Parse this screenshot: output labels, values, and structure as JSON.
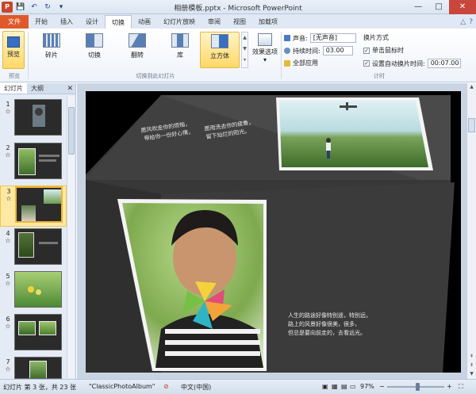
{
  "window": {
    "title": "相册模板.pptx - Microsoft PowerPoint",
    "app_icon_label": "P",
    "minimize": "—",
    "maximize": "□",
    "close": "✕"
  },
  "quick_access": {
    "save": "💾",
    "undo": "↶",
    "redo": "↻",
    "customize": "▾"
  },
  "tabs": [
    "文件",
    "开始",
    "插入",
    "设计",
    "切换",
    "动画",
    "幻灯片放映",
    "审阅",
    "视图",
    "加载项"
  ],
  "active_tab_index": 4,
  "ribbon": {
    "preview_label": "预览",
    "preview_group": "预览",
    "transitions": [
      "碎片",
      "切换",
      "翻转",
      "库",
      "立方体"
    ],
    "selected_transition": "立方体",
    "effect_options": "效果选项",
    "transition_group": "切换到此幻灯片",
    "timing_group": "计时",
    "sound_label": "声音:",
    "sound_value": "[无声音]",
    "duration_label": "持续时间:",
    "duration_value": "03.00",
    "apply_all": "全部应用",
    "advance_title": "换片方式",
    "on_click_label": "单击鼠标时",
    "on_click_checked": true,
    "auto_after_label": "设置自动换片时间:",
    "auto_after_checked": true,
    "auto_after_value": "00:07.00"
  },
  "left_panel": {
    "tab_slides": "幻灯片",
    "tab_outline": "大纲",
    "close": "✕",
    "slides": [
      {
        "number": "1",
        "mark": "☆"
      },
      {
        "number": "2",
        "mark": "☆"
      },
      {
        "number": "3",
        "mark": "☆"
      },
      {
        "number": "4",
        "mark": "☆"
      },
      {
        "number": "5",
        "mark": "☆"
      },
      {
        "number": "6",
        "mark": "☆"
      },
      {
        "number": "7",
        "mark": "☆"
      }
    ],
    "selected_slide": 3
  },
  "slide": {
    "poem_top": [
      "愿风吹走你的烦恼，",
      "带给你一份好心情，",
      "愿雨洗去你的疲惫，",
      "留下灿烂的阳光。"
    ],
    "poem_bottom": [
      "人生的路途好像特别遥，特别远，",
      "路上的风景好像很美，很多，",
      "但总是要向前走的，去看远光。"
    ]
  },
  "status": {
    "slide_info": "幻灯片 第 3 张，共 23 张",
    "theme": "\"ClassicPhotoAlbum\"",
    "language": "中文(中国)",
    "zoom": "97%",
    "zoom_minus": "−",
    "zoom_plus": "+"
  },
  "colors": {
    "accent": "#e0592a",
    "selection": "#fde9a4",
    "ribbon_bg": "#eef3fa"
  }
}
